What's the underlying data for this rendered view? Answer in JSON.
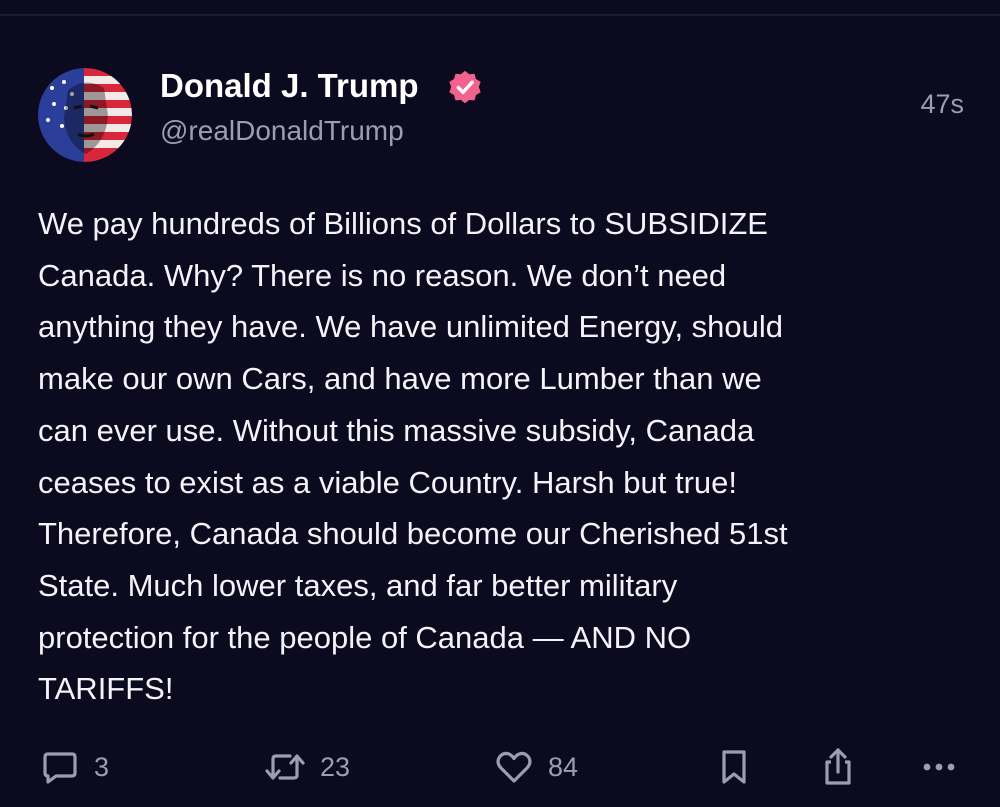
{
  "post": {
    "author_name": "Donald J. Trump",
    "handle": "@realDonaldTrump",
    "timestamp": "47s",
    "text": "We pay hundreds of Billions of Dollars to SUBSIDIZE\nCanada. Why? There is no reason. We don’t need\nanything they have. We have unlimited Energy, should\nmake our own Cars, and have more Lumber than we\ncan ever use. Without this massive subsidy, Canada\nceases to exist as a viable Country. Harsh but true!\nTherefore, Canada should become our Cherished 51st\nState. Much lower taxes, and far better military\nprotection for the people of Canada — AND NO\nTARIFFS!",
    "verified_badge_color": "#f3628f"
  },
  "actions": {
    "reply_count": "3",
    "repost_count": "23",
    "like_count": "84",
    "icons": [
      "comment-icon",
      "repost-icon",
      "heart-icon",
      "bookmark-icon",
      "share-icon",
      "more-icon"
    ]
  },
  "colors": {
    "background": "#0c0a1e",
    "text_primary": "#f4f3f8",
    "text_secondary": "#9e9cb2"
  }
}
